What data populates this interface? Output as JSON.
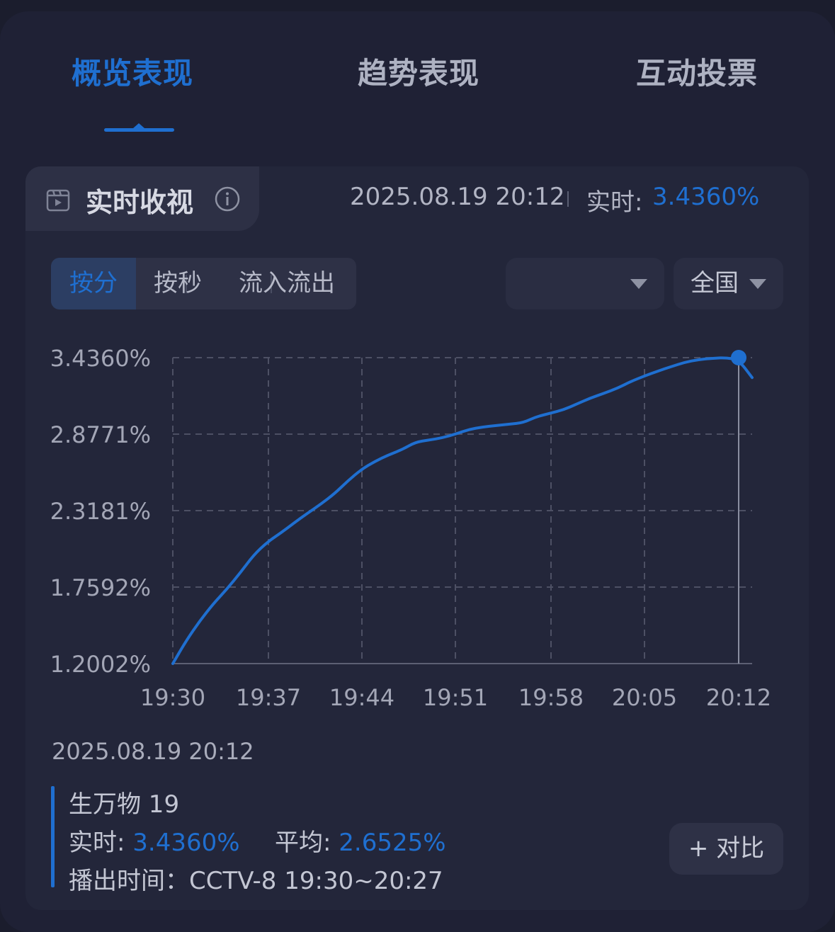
{
  "tabs": [
    {
      "label": "概览表现",
      "active": true
    },
    {
      "label": "趋势表现",
      "active": false
    },
    {
      "label": "互动投票",
      "active": false
    }
  ],
  "section": {
    "title": "实时收视",
    "timestamp": "2025.08.19 20:12",
    "realtime_label": "实时:",
    "realtime_value": "3.4360%"
  },
  "segments": [
    "按分",
    "按秒",
    "流入流出"
  ],
  "filters": {
    "channel": "",
    "region": "全国"
  },
  "chart_data": {
    "type": "line",
    "y_tick_labels": [
      "3.4360%",
      "2.8771%",
      "2.3181%",
      "1.7592%",
      "1.2002%"
    ],
    "x_tick_labels": [
      "19:30",
      "19:37",
      "19:44",
      "19:51",
      "19:58",
      "20:05",
      "20:12"
    ],
    "ylim": [
      1.2002,
      3.436
    ],
    "xlim": [
      0,
      42
    ],
    "grid": true,
    "color": "#1f6fd0",
    "series": [
      {
        "x": [
          0,
          1,
          2,
          3,
          4,
          5,
          6,
          7,
          8,
          9,
          10,
          11,
          12,
          13,
          14,
          15,
          16,
          17,
          18,
          19,
          20,
          21,
          22,
          23,
          24,
          25,
          26,
          27,
          28,
          29,
          30,
          31,
          32,
          33,
          34,
          35,
          36,
          37,
          38,
          39,
          40,
          41,
          42,
          43
        ],
        "y": [
          1.2002,
          1.368,
          1.511,
          1.637,
          1.743,
          1.863,
          1.993,
          2.087,
          2.154,
          2.228,
          2.299,
          2.367,
          2.442,
          2.536,
          2.619,
          2.678,
          2.725,
          2.763,
          2.818,
          2.834,
          2.85,
          2.878,
          2.912,
          2.929,
          2.94,
          2.95,
          2.96,
          3.005,
          3.029,
          3.055,
          3.098,
          3.141,
          3.175,
          3.213,
          3.262,
          3.302,
          3.337,
          3.371,
          3.402,
          3.421,
          3.431,
          3.436,
          3.42,
          3.29
        ]
      }
    ],
    "marker": {
      "x": 42,
      "y": 3.436
    }
  },
  "detail": {
    "date": "2025.08.19 20:12",
    "program": "生万物 19",
    "realtime_label": "实时:",
    "realtime_value": "3.4360%",
    "avg_label": "平均:",
    "avg_value": "2.6525%",
    "airtime": "播出时间：CCTV-8 19:30~20:27"
  },
  "compare_button": "+ 对比"
}
